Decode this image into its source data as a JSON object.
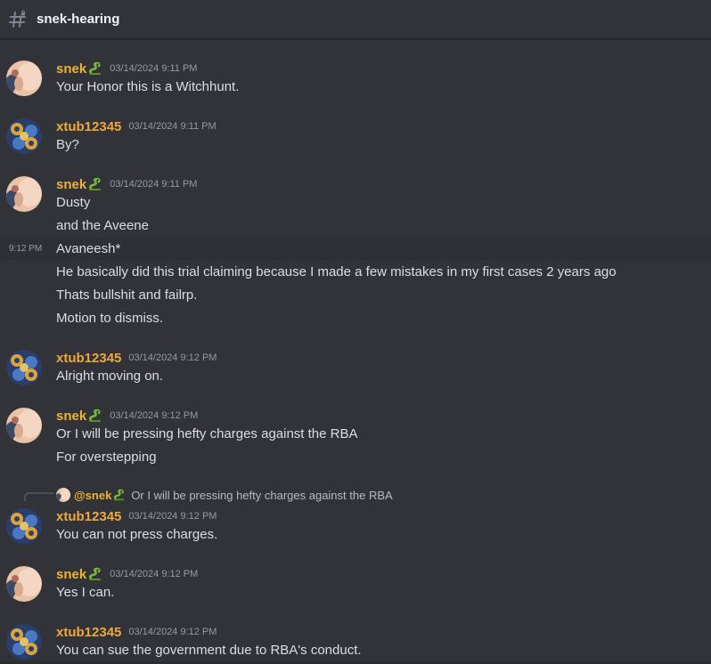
{
  "channel": {
    "name": "snek-hearing",
    "icon": "hashtag-icon"
  },
  "users": {
    "snek": {
      "name": "snek",
      "color": "#f0b232",
      "badge_icon": "snake-icon"
    },
    "xtub": {
      "name": "xtub12345",
      "color": "#f0a73c"
    }
  },
  "messages": [
    {
      "author": "snek",
      "timestamp": "03/14/2024 9:11 PM",
      "lines": [
        "Your Honor this is a Witchhunt."
      ]
    },
    {
      "author": "xtub12345",
      "timestamp": "03/14/2024 9:11 PM",
      "lines": [
        "By?"
      ]
    },
    {
      "author": "snek",
      "timestamp": "03/14/2024 9:11 PM",
      "lines": [
        "Dusty",
        "and the Aveene"
      ]
    },
    {
      "author": "snek",
      "hover_time": "9:12 PM",
      "lines": [
        "Avaneesh*",
        "He basically did this trial claiming because I made a few mistakes in my first cases 2 years ago",
        "Thats bullshit and failrp.",
        "Motion to dismiss."
      ]
    },
    {
      "author": "xtub12345",
      "timestamp": "03/14/2024 9:12 PM",
      "lines": [
        "Alright moving on."
      ]
    },
    {
      "author": "snek",
      "timestamp": "03/14/2024 9:12 PM",
      "lines": [
        "Or I will be pressing hefty charges against the RBA",
        "For overstepping"
      ]
    },
    {
      "author": "xtub12345",
      "timestamp": "03/14/2024 9:12 PM",
      "reply": {
        "user": "@snek",
        "text": "Or I will be pressing hefty charges against the RBA"
      },
      "lines": [
        "You can not press charges."
      ]
    },
    {
      "author": "snek",
      "timestamp": "03/14/2024 9:12 PM",
      "lines": [
        "Yes I can."
      ]
    },
    {
      "author": "xtub12345",
      "timestamp": "03/14/2024 9:12 PM",
      "lines": [
        "You can sue the government due to RBA's conduct."
      ]
    }
  ]
}
